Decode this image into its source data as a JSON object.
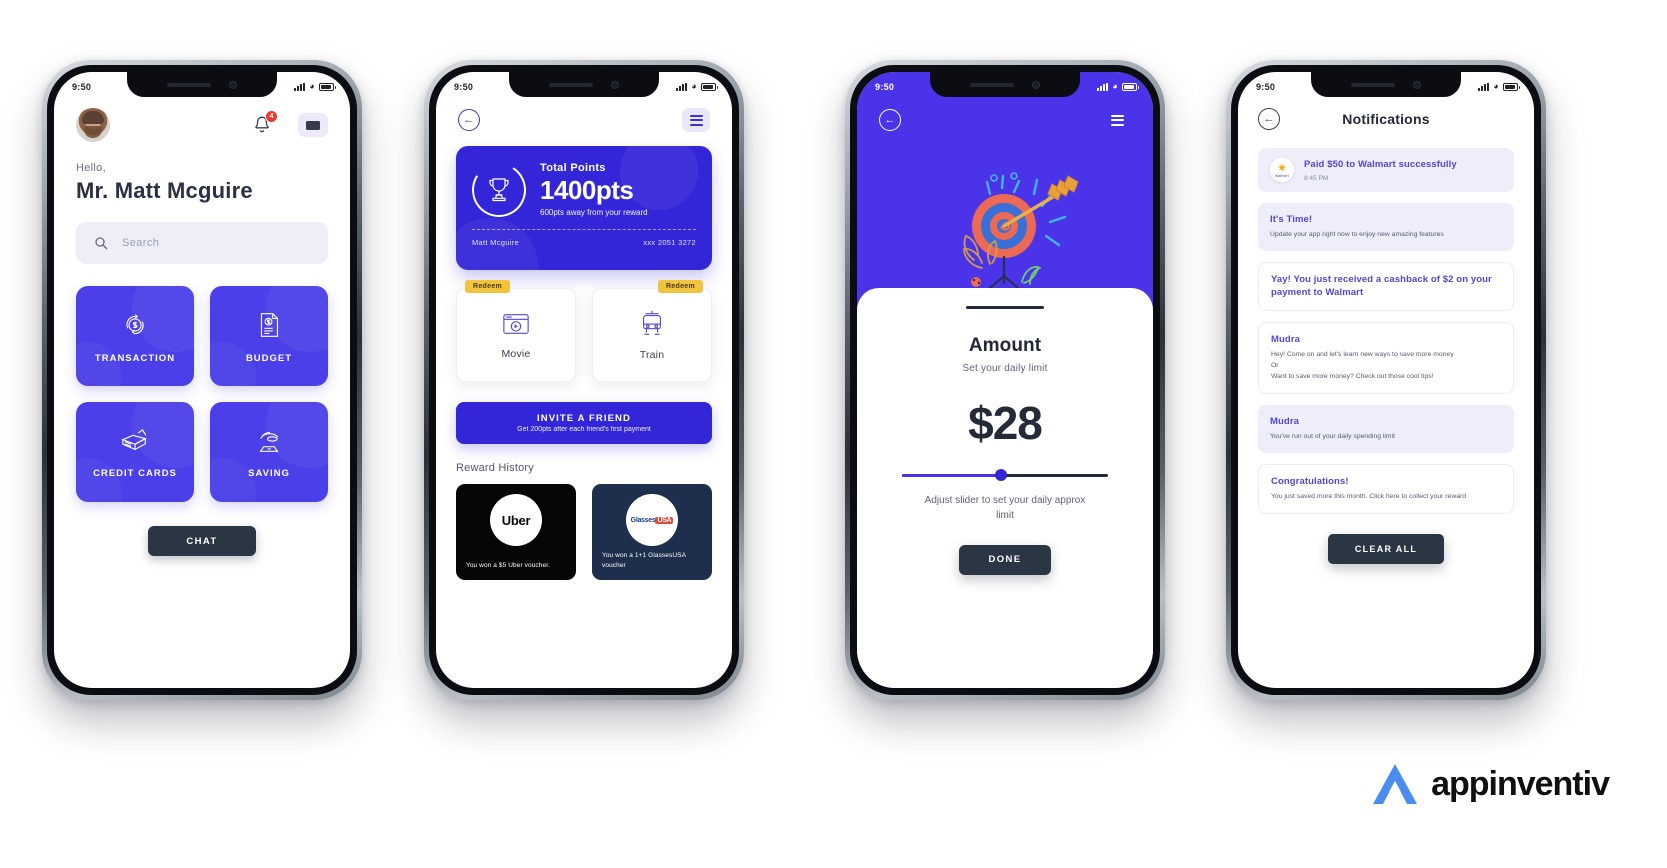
{
  "brand": {
    "name": "appinventiv",
    "logo_color": "#4a8cf0"
  },
  "theme": {
    "primary": "#3326d8",
    "tile": "#4a3fe8",
    "dark": "#2b3644",
    "accent_yellow": "#f2c43d",
    "notif_bg": "#eeedfa"
  },
  "phone1": {
    "status": {
      "time": "9:50"
    },
    "notification_badge": "4",
    "greeting": "Hello,",
    "user_name": "Mr. Matt Mcguire",
    "search": {
      "placeholder": "Search"
    },
    "tiles": [
      {
        "label": "TRANSACTION",
        "icon": "dollar-refresh-icon"
      },
      {
        "label": "BUDGET",
        "icon": "budget-document-icon"
      },
      {
        "label": "CREDIT CARDS",
        "icon": "credit-cards-icon"
      },
      {
        "label": "SAVING",
        "icon": "saving-hand-icon"
      }
    ],
    "chat_label": "CHAT"
  },
  "phone2": {
    "status": {
      "time": "9:50"
    },
    "points_card": {
      "label": "Total Points",
      "value": "1400pts",
      "sub": "600pts away from your reward",
      "holder": "Matt Mcguire",
      "card_number": "xxx 2051 3272"
    },
    "redeem": [
      {
        "tag": "Redeem",
        "label": "Movie",
        "icon": "movie-player-icon"
      },
      {
        "tag": "Redeem",
        "label": "Train",
        "icon": "train-icon"
      }
    ],
    "invite": {
      "title": "INVITE A FRIEND",
      "sub": "Get 200pts after each friend's first payment"
    },
    "reward_history": {
      "title": "Reward History",
      "items": [
        {
          "brand": "Uber",
          "caption": "You won a $5 Uber voucher."
        },
        {
          "brand": "GlassesUSA",
          "caption": "You won a 1+1 GlassesUSA voucher"
        }
      ]
    }
  },
  "phone3": {
    "status": {
      "time": "9:50"
    },
    "illustration": "target-arrow-icon",
    "title": "Amount",
    "subtitle": "Set your daily limit",
    "amount": "$28",
    "slider": {
      "percent": 48
    },
    "hint": "Adjust slider to set your daily approx limit",
    "done_label": "DONE"
  },
  "phone4": {
    "status": {
      "time": "9:50"
    },
    "title": "Notifications",
    "notifications": [
      {
        "style": "tinted",
        "icon": "walmart-logo-icon",
        "title": "Paid $50 to Walmart successfully",
        "time": "8:45 PM",
        "body": ""
      },
      {
        "style": "tinted",
        "title": "It's Time!",
        "body": "Update your app right now to enjoy new amazing features",
        "time": ""
      },
      {
        "style": "plain",
        "title": "Yay! You just received a cashback of $2 on your payment to Walmart",
        "body": "",
        "time": ""
      },
      {
        "style": "plain",
        "title": "Mudra",
        "body": "Hey! Come on and let's learn new ways to save more money\nOr\nWant to save more money? Check out those cool tips!",
        "time": ""
      },
      {
        "style": "tinted",
        "title": "Mudra",
        "body": "You've run out of your daily spending limit",
        "time": ""
      },
      {
        "style": "plain",
        "title": "Congratulations!",
        "body": "You just saved more this month. Click here to collect your reward",
        "time": ""
      }
    ],
    "clear_label": "CLEAR ALL"
  }
}
